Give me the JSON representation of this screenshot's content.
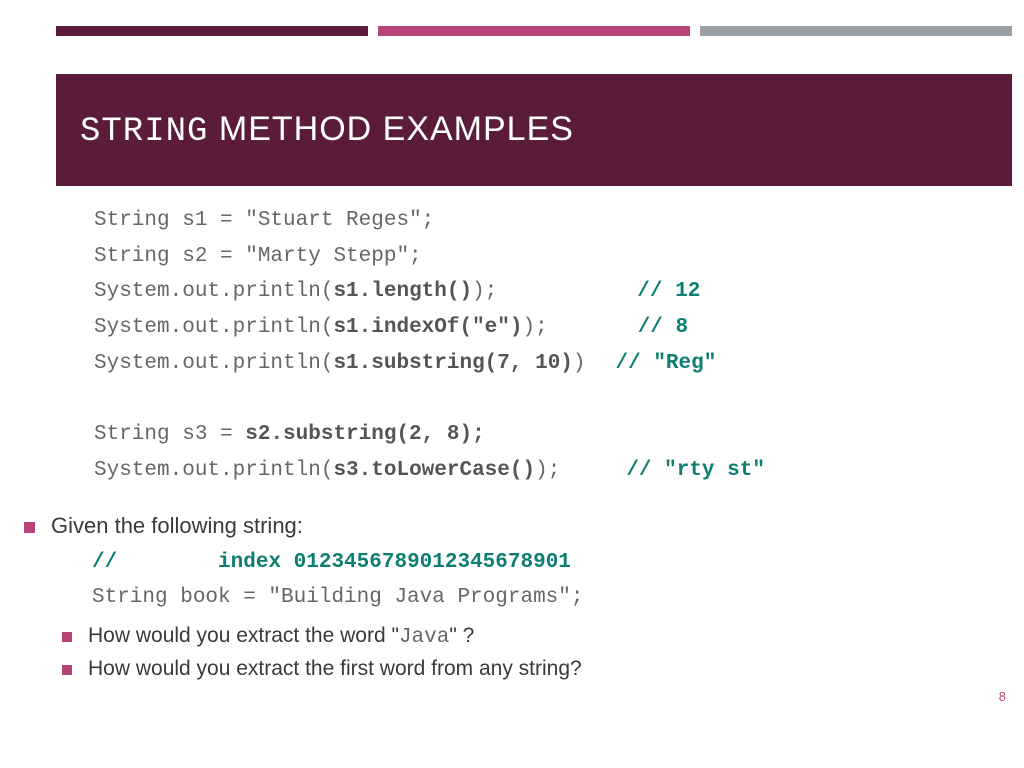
{
  "title": {
    "mono": "STRING",
    "sans": " METHOD EXAMPLES"
  },
  "code": {
    "l1_pre": "String s1 = \"",
    "l1_mid": "Stuart Reges",
    "l1_post": "\";",
    "l2_pre": "String s2 = \"",
    "l2_mid": "Marty Stepp",
    "l2_post": "\";",
    "l3_pre": "System.out.println(",
    "l3_bold": "s1.length()",
    "l3_post": ");",
    "l3_comment": "// 12",
    "l4_pre": "System.out.println(",
    "l4_bold": "s1.indexOf(\"e\")",
    "l4_post": ");",
    "l4_comment": "// 8",
    "l5_pre": "System.out.println(",
    "l5_bold": "s1.substring(7, 10)",
    "l5_post": ")",
    "l5_comment": "// \"Reg\"",
    "l6_pre": "String s3 = ",
    "l6_bold": "s2.substring(2, 8);",
    "l7_pre": "System.out.println(",
    "l7_bold": "s3.toLowerCase()",
    "l7_post": ");",
    "l7_comment": "// \"rty st\""
  },
  "q": {
    "intro": "Given the following string:",
    "idx_pre": "//",
    "idx_rest": "        index 0123456789012345678901",
    "book_pre": "String book = \"",
    "book_mid": "Building Java Programs",
    "book_post": "\";",
    "q1_a": "How would you extract the word \"",
    "q1_b": "Java",
    "q1_c": "\" ?",
    "q2": "How would you extract the first word from any string?"
  },
  "page_number": "8"
}
